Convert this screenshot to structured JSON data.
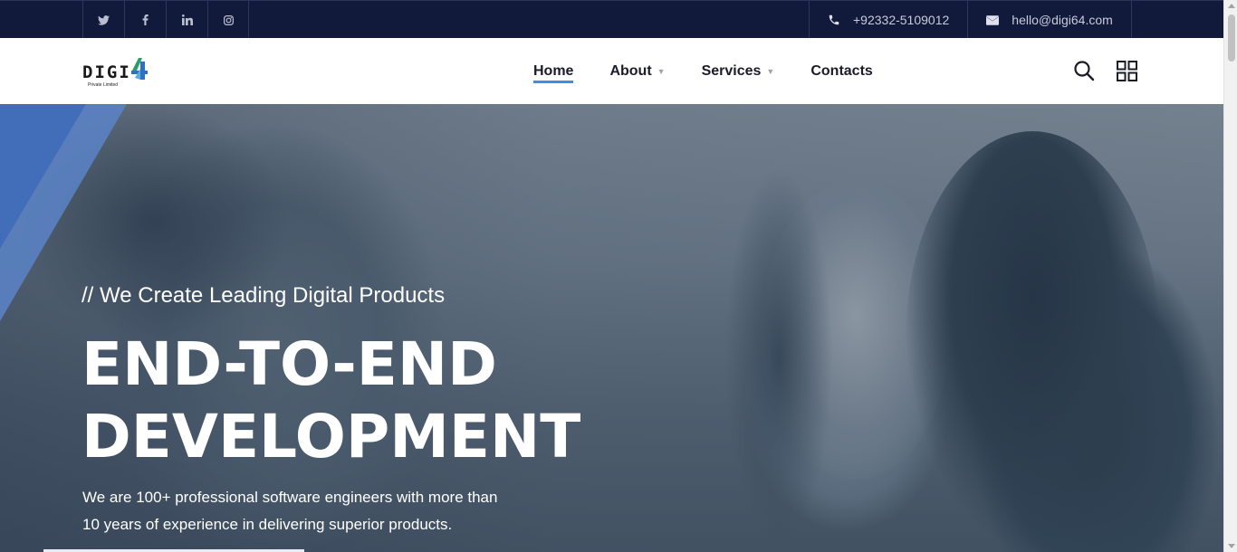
{
  "topbar": {
    "social": [
      {
        "icon": "twitter-icon",
        "glyph": "t"
      },
      {
        "icon": "facebook-icon",
        "glyph": "f"
      },
      {
        "icon": "linkedin-icon",
        "glyph": "in"
      },
      {
        "icon": "instagram-icon",
        "glyph": "◎"
      }
    ],
    "phone": "+92332-5109012",
    "email": "hello@digi64.com"
  },
  "header": {
    "logo_text": "DIGI",
    "logo_sub": "Private Limited",
    "nav": [
      {
        "label": "Home",
        "active": true,
        "dropdown": false
      },
      {
        "label": "About",
        "active": false,
        "dropdown": true
      },
      {
        "label": "Services",
        "active": false,
        "dropdown": true
      },
      {
        "label": "Contacts",
        "active": false,
        "dropdown": false
      }
    ],
    "caret": "▼"
  },
  "hero": {
    "subtitle": "// We Create Leading Digital Products",
    "title_line1": "END-TO-END",
    "title_line2": "DEVELOPMENT",
    "description_line1": "We are 100+ professional software engineers with more than",
    "description_line2": "10 years of experience in delivering superior products."
  },
  "colors": {
    "topbar_bg": "#111a3a",
    "accent": "#3d8ee8",
    "hero_stripe": "#5b84c8"
  }
}
